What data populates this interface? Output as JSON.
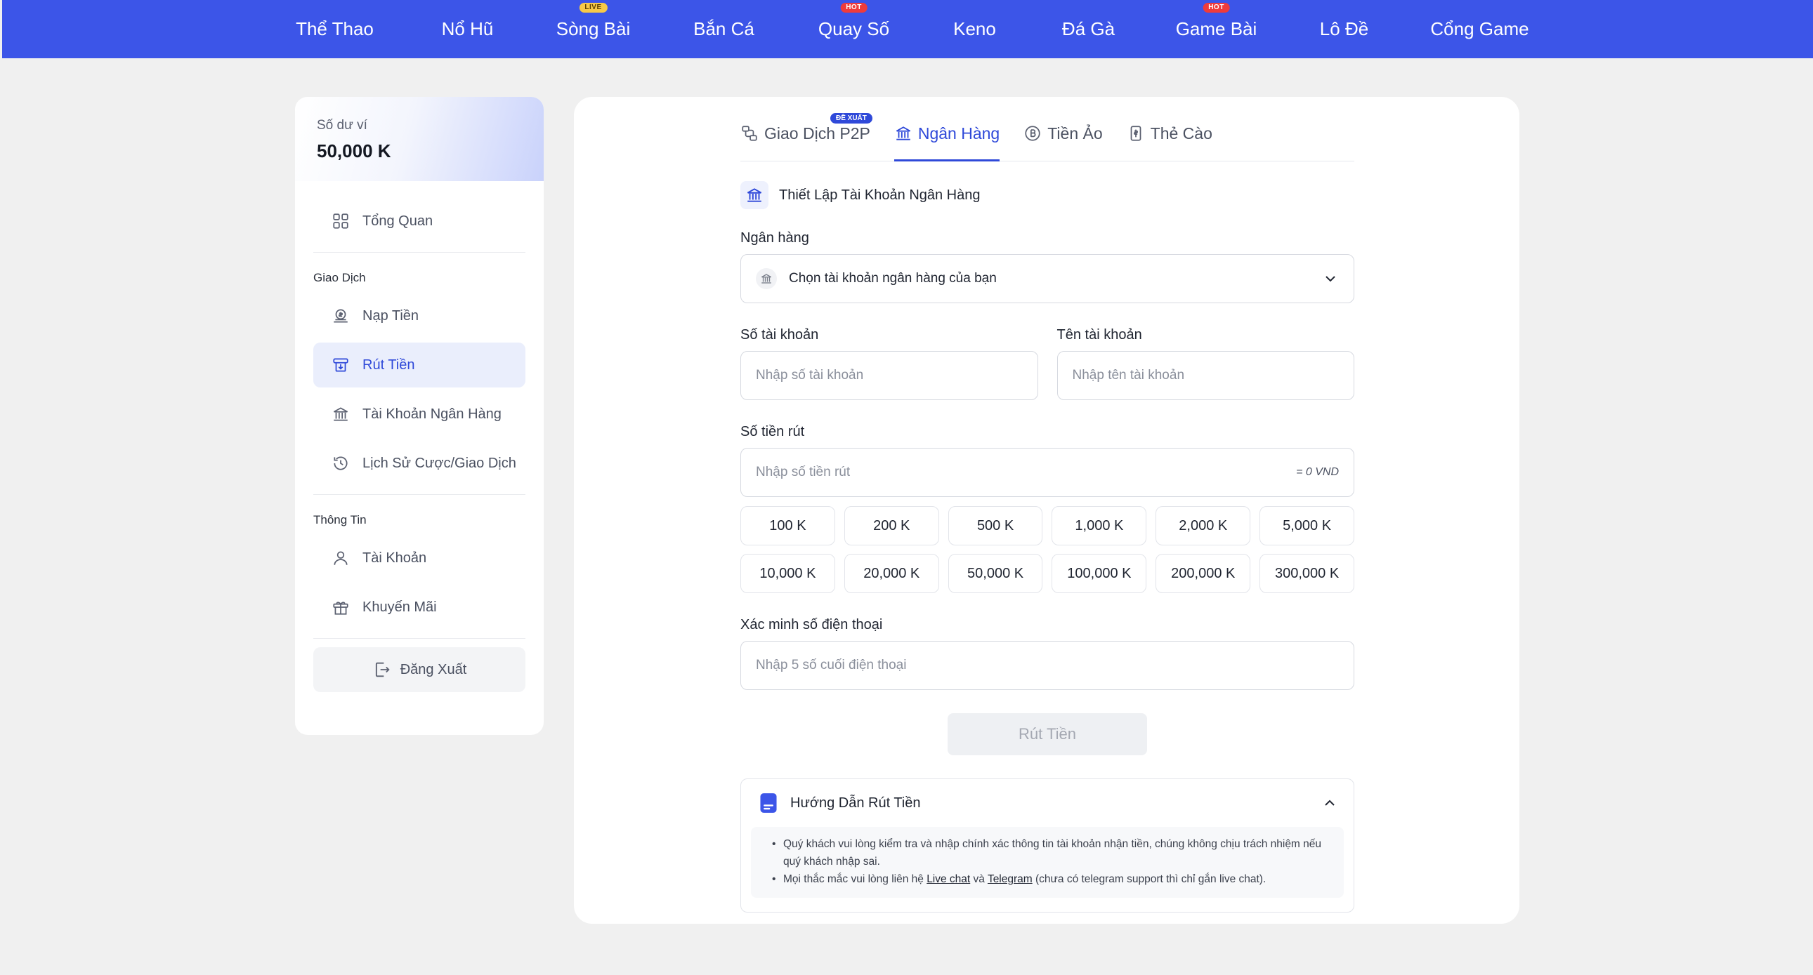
{
  "nav": {
    "items": [
      {
        "label": "Thể Thao",
        "badge": ""
      },
      {
        "label": "Nổ Hũ",
        "badge": ""
      },
      {
        "label": "Sòng Bài",
        "badge": "LIVE"
      },
      {
        "label": "Bắn Cá",
        "badge": ""
      },
      {
        "label": "Quay Số",
        "badge": "HOT"
      },
      {
        "label": "Keno",
        "badge": ""
      },
      {
        "label": "Đá Gà",
        "badge": ""
      },
      {
        "label": "Game Bài",
        "badge": "HOT"
      },
      {
        "label": "Lô Đề",
        "badge": ""
      },
      {
        "label": "Cổng Game",
        "badge": ""
      }
    ]
  },
  "sidebar": {
    "wallet_label": "Số dư ví",
    "wallet_value": "50,000 K",
    "overview": "Tổng Quan",
    "group_transactions": "Giao Dịch",
    "deposit": "Nạp Tiền",
    "withdraw": "Rút Tiền",
    "bank_account": "Tài Khoản Ngân Hàng",
    "history": "Lịch Sử Cược/Giao Dịch",
    "group_info": "Thông Tin",
    "account": "Tài Khoản",
    "promotion": "Khuyến Mãi",
    "logout": "Đăng Xuất"
  },
  "tabs": {
    "p2p": "Giao Dịch P2P",
    "p2p_badge": "ĐỀ XUẤT",
    "bank": "Ngân Hàng",
    "crypto": "Tiền Ảo",
    "card": "Thẻ Cào"
  },
  "form": {
    "section_title": "Thiết Lập Tài Khoản Ngân Hàng",
    "bank_label": "Ngân hàng",
    "bank_select": "Chọn tài khoản ngân hàng của bạn",
    "account_no_label": "Số tài khoản",
    "account_no_placeholder": "Nhập số tài khoản",
    "account_name_label": "Tên tài khoản",
    "account_name_placeholder": "Nhập tên tài khoản",
    "amount_label": "Số tiền rút",
    "amount_placeholder": "Nhập số tiền rút",
    "amount_suffix": "= 0 VND",
    "amounts": [
      "100 K",
      "200 K",
      "500 K",
      "1,000 K",
      "2,000 K",
      "5,000 K",
      "10,000 K",
      "20,000 K",
      "50,000 K",
      "100,000 K",
      "200,000 K",
      "300,000 K"
    ],
    "phone_label": "Xác minh số điện thoại",
    "phone_placeholder": "Nhập 5 số cuối điện thoại",
    "submit": "Rút Tiền"
  },
  "guide": {
    "title": "Hướng Dẫn Rút Tiền",
    "item1": "Quý khách vui lòng kiểm tra và nhập chính xác thông tin tài khoản nhận tiền, chúng không chịu trách nhiệm nếu quý khách nhập sai.",
    "item2_before": "Mọi thắc mắc vui lòng liên hệ ",
    "item2_link1": "Live chat",
    "item2_mid": " và ",
    "item2_link2": "Telegram",
    "item2_after": " (chưa có telegram support thì chỉ gắn live chat)."
  },
  "colors": {
    "brand": "#3c55e8",
    "accent": "#2f49d9",
    "live_badge": "#f7c948",
    "hot_badge": "#ef3b3b"
  }
}
